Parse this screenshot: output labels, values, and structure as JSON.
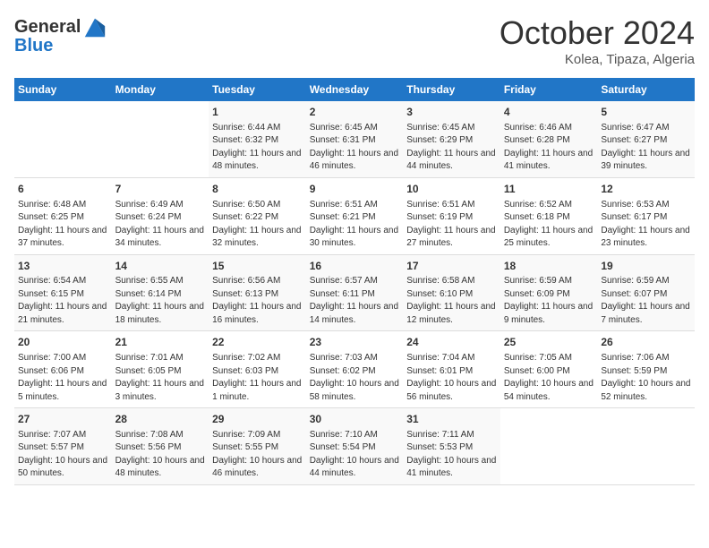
{
  "header": {
    "logo_line1": "General",
    "logo_line2": "Blue",
    "month": "October 2024",
    "location": "Kolea, Tipaza, Algeria"
  },
  "days_of_week": [
    "Sunday",
    "Monday",
    "Tuesday",
    "Wednesday",
    "Thursday",
    "Friday",
    "Saturday"
  ],
  "weeks": [
    [
      {
        "day": "",
        "content": ""
      },
      {
        "day": "",
        "content": ""
      },
      {
        "day": "1",
        "content": "Sunrise: 6:44 AM\nSunset: 6:32 PM\nDaylight: 11 hours and 48 minutes."
      },
      {
        "day": "2",
        "content": "Sunrise: 6:45 AM\nSunset: 6:31 PM\nDaylight: 11 hours and 46 minutes."
      },
      {
        "day": "3",
        "content": "Sunrise: 6:45 AM\nSunset: 6:29 PM\nDaylight: 11 hours and 44 minutes."
      },
      {
        "day": "4",
        "content": "Sunrise: 6:46 AM\nSunset: 6:28 PM\nDaylight: 11 hours and 41 minutes."
      },
      {
        "day": "5",
        "content": "Sunrise: 6:47 AM\nSunset: 6:27 PM\nDaylight: 11 hours and 39 minutes."
      }
    ],
    [
      {
        "day": "6",
        "content": "Sunrise: 6:48 AM\nSunset: 6:25 PM\nDaylight: 11 hours and 37 minutes."
      },
      {
        "day": "7",
        "content": "Sunrise: 6:49 AM\nSunset: 6:24 PM\nDaylight: 11 hours and 34 minutes."
      },
      {
        "day": "8",
        "content": "Sunrise: 6:50 AM\nSunset: 6:22 PM\nDaylight: 11 hours and 32 minutes."
      },
      {
        "day": "9",
        "content": "Sunrise: 6:51 AM\nSunset: 6:21 PM\nDaylight: 11 hours and 30 minutes."
      },
      {
        "day": "10",
        "content": "Sunrise: 6:51 AM\nSunset: 6:19 PM\nDaylight: 11 hours and 27 minutes."
      },
      {
        "day": "11",
        "content": "Sunrise: 6:52 AM\nSunset: 6:18 PM\nDaylight: 11 hours and 25 minutes."
      },
      {
        "day": "12",
        "content": "Sunrise: 6:53 AM\nSunset: 6:17 PM\nDaylight: 11 hours and 23 minutes."
      }
    ],
    [
      {
        "day": "13",
        "content": "Sunrise: 6:54 AM\nSunset: 6:15 PM\nDaylight: 11 hours and 21 minutes."
      },
      {
        "day": "14",
        "content": "Sunrise: 6:55 AM\nSunset: 6:14 PM\nDaylight: 11 hours and 18 minutes."
      },
      {
        "day": "15",
        "content": "Sunrise: 6:56 AM\nSunset: 6:13 PM\nDaylight: 11 hours and 16 minutes."
      },
      {
        "day": "16",
        "content": "Sunrise: 6:57 AM\nSunset: 6:11 PM\nDaylight: 11 hours and 14 minutes."
      },
      {
        "day": "17",
        "content": "Sunrise: 6:58 AM\nSunset: 6:10 PM\nDaylight: 11 hours and 12 minutes."
      },
      {
        "day": "18",
        "content": "Sunrise: 6:59 AM\nSunset: 6:09 PM\nDaylight: 11 hours and 9 minutes."
      },
      {
        "day": "19",
        "content": "Sunrise: 6:59 AM\nSunset: 6:07 PM\nDaylight: 11 hours and 7 minutes."
      }
    ],
    [
      {
        "day": "20",
        "content": "Sunrise: 7:00 AM\nSunset: 6:06 PM\nDaylight: 11 hours and 5 minutes."
      },
      {
        "day": "21",
        "content": "Sunrise: 7:01 AM\nSunset: 6:05 PM\nDaylight: 11 hours and 3 minutes."
      },
      {
        "day": "22",
        "content": "Sunrise: 7:02 AM\nSunset: 6:03 PM\nDaylight: 11 hours and 1 minute."
      },
      {
        "day": "23",
        "content": "Sunrise: 7:03 AM\nSunset: 6:02 PM\nDaylight: 10 hours and 58 minutes."
      },
      {
        "day": "24",
        "content": "Sunrise: 7:04 AM\nSunset: 6:01 PM\nDaylight: 10 hours and 56 minutes."
      },
      {
        "day": "25",
        "content": "Sunrise: 7:05 AM\nSunset: 6:00 PM\nDaylight: 10 hours and 54 minutes."
      },
      {
        "day": "26",
        "content": "Sunrise: 7:06 AM\nSunset: 5:59 PM\nDaylight: 10 hours and 52 minutes."
      }
    ],
    [
      {
        "day": "27",
        "content": "Sunrise: 7:07 AM\nSunset: 5:57 PM\nDaylight: 10 hours and 50 minutes."
      },
      {
        "day": "28",
        "content": "Sunrise: 7:08 AM\nSunset: 5:56 PM\nDaylight: 10 hours and 48 minutes."
      },
      {
        "day": "29",
        "content": "Sunrise: 7:09 AM\nSunset: 5:55 PM\nDaylight: 10 hours and 46 minutes."
      },
      {
        "day": "30",
        "content": "Sunrise: 7:10 AM\nSunset: 5:54 PM\nDaylight: 10 hours and 44 minutes."
      },
      {
        "day": "31",
        "content": "Sunrise: 7:11 AM\nSunset: 5:53 PM\nDaylight: 10 hours and 41 minutes."
      },
      {
        "day": "",
        "content": ""
      },
      {
        "day": "",
        "content": ""
      }
    ]
  ]
}
